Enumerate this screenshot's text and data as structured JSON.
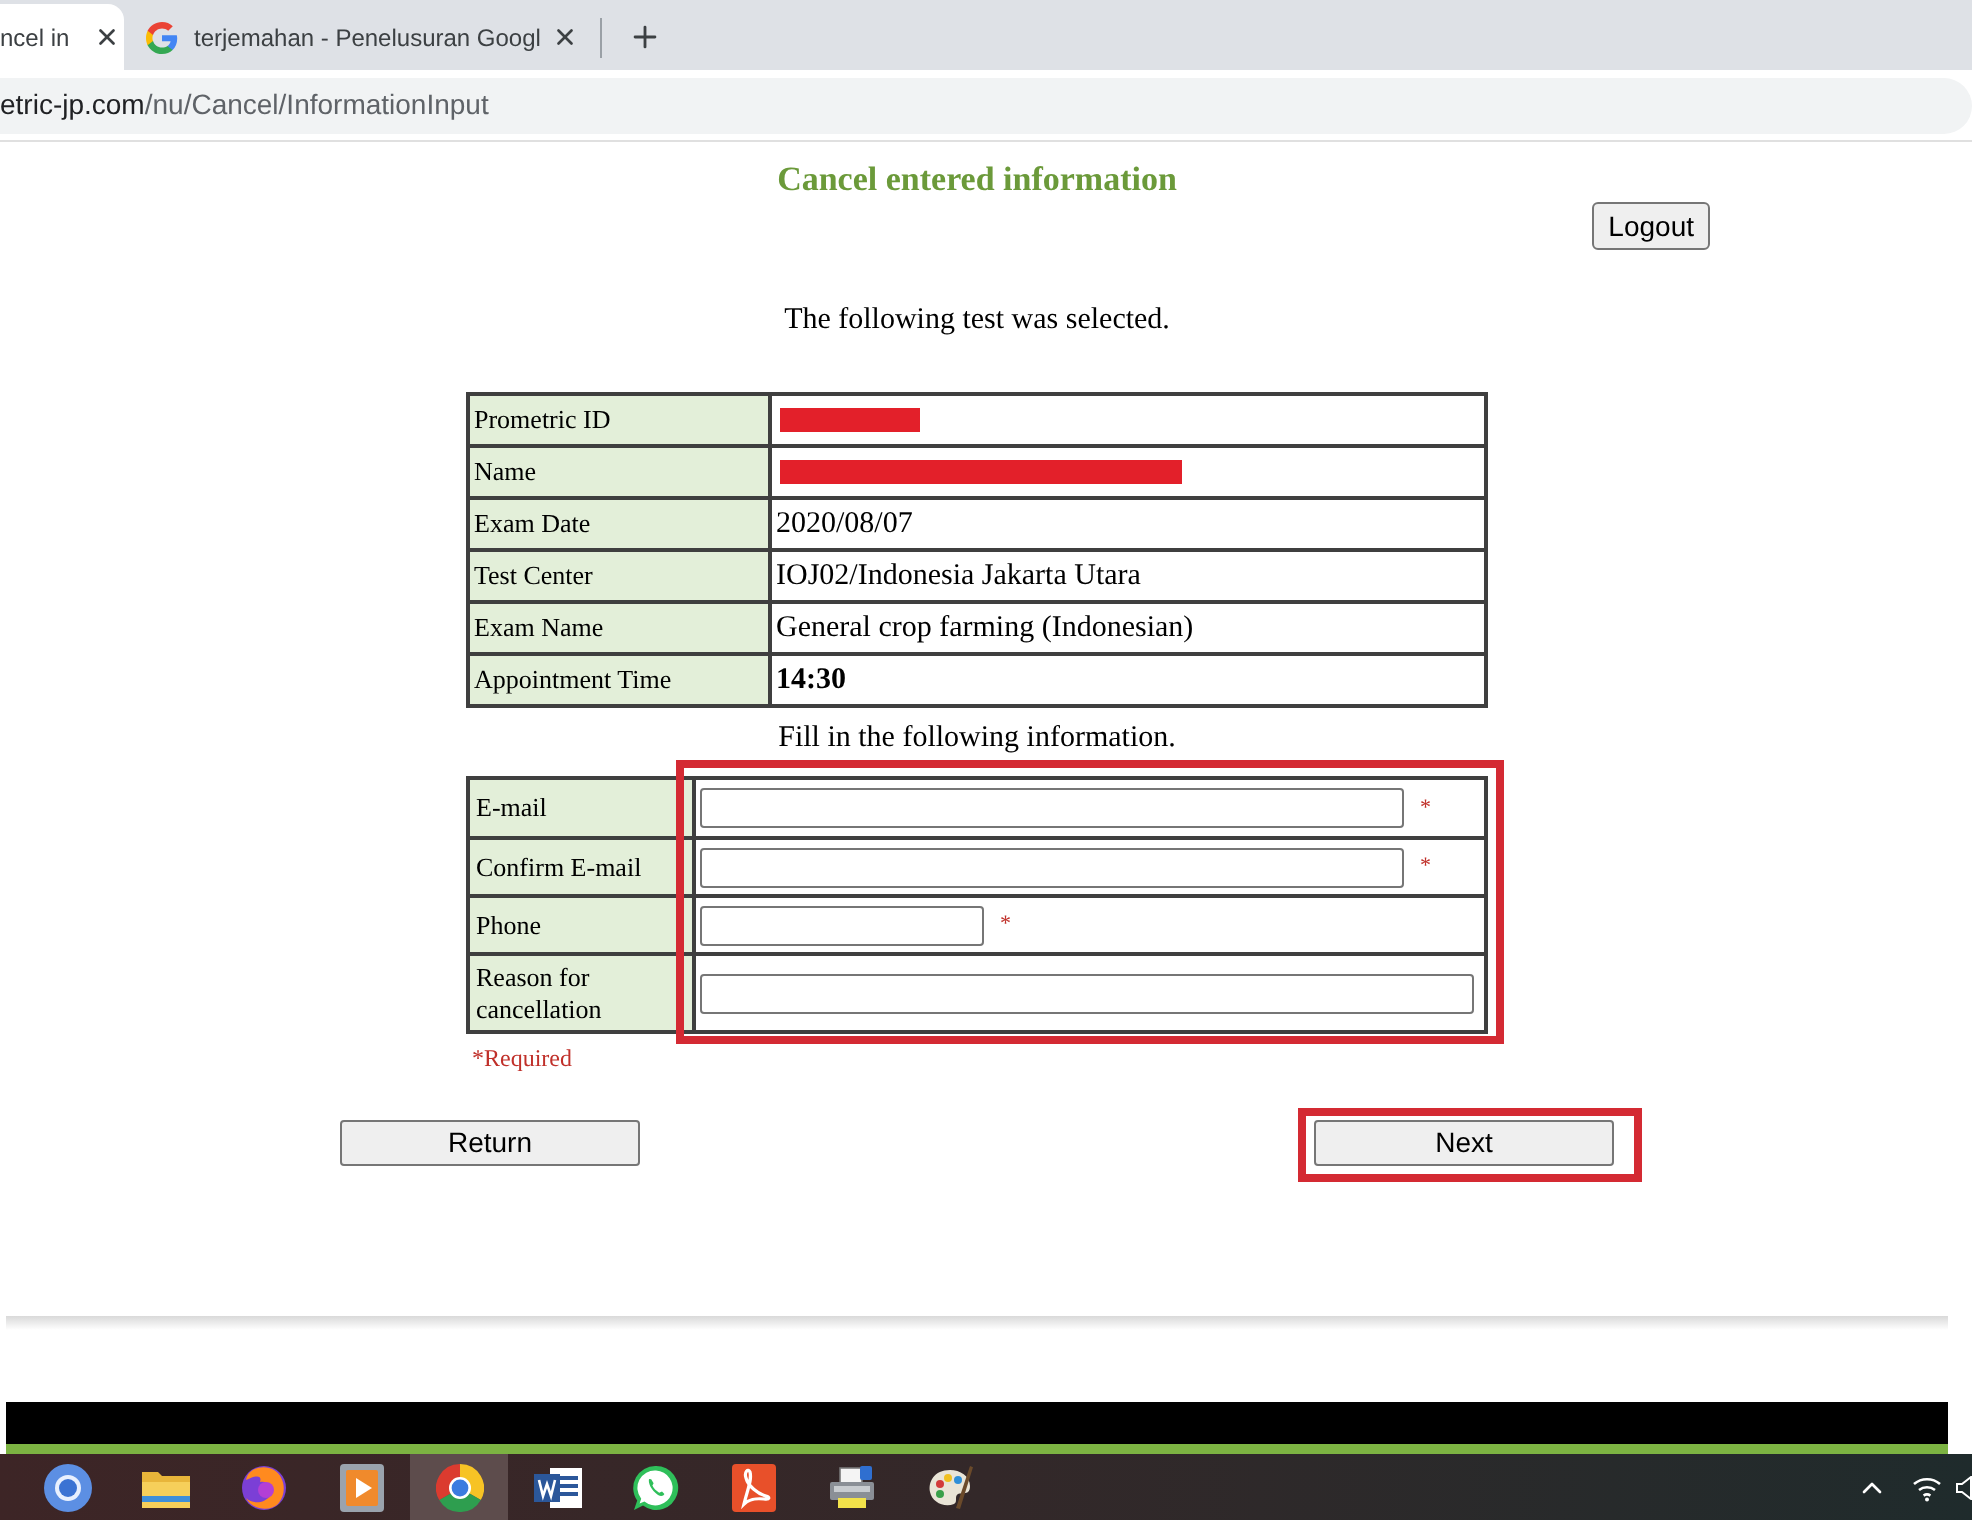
{
  "browser": {
    "tabs": [
      {
        "label": "ncel in",
        "selected": true
      },
      {
        "label": "terjemahan - Penelusuran Googl",
        "selected": false
      }
    ],
    "address_host": "etric-jp.com",
    "address_path": "/nu/Cancel/InformationInput"
  },
  "page": {
    "title": "Cancel entered information",
    "logout_button": "Logout",
    "selected_intro": "The following test was selected.",
    "test_details": [
      {
        "label": "Prometric ID",
        "redacted": true
      },
      {
        "label": "Name",
        "redacted": true
      },
      {
        "label": "Exam Date",
        "value": "2020/08/07"
      },
      {
        "label": "Test Center",
        "value": "IOJ02/Indonesia Jakarta Utara"
      },
      {
        "label": "Exam Name",
        "value": "General crop farming (Indonesian)"
      },
      {
        "label": "Appointment Time",
        "value": "14:30",
        "bold": true
      }
    ],
    "form_intro": "Fill in the following information.",
    "form": {
      "highlighted": true,
      "fields": [
        {
          "label": "E-mail",
          "kind": "long",
          "mark": "*"
        },
        {
          "label": "Confirm E-mail",
          "kind": "long",
          "mark": "*"
        },
        {
          "label": "Phone",
          "kind": "short",
          "mark": "*"
        },
        {
          "label": "Reason for cancellation",
          "kind": "full"
        }
      ]
    },
    "required_note": "*Required",
    "buttons": [
      {
        "label": "Return",
        "highlighted": false
      },
      {
        "label": "Next",
        "highlighted": true
      }
    ]
  },
  "taskbar": {
    "apps": [
      {
        "kind": "round-logo",
        "selected": false
      },
      {
        "kind": "folder",
        "selected": false
      },
      {
        "kind": "flame-globe",
        "selected": false
      },
      {
        "kind": "media",
        "selected": false
      },
      {
        "kind": "ring-logo",
        "selected": true
      },
      {
        "kind": "doc-tile",
        "selected": false
      },
      {
        "kind": "chat",
        "selected": false
      },
      {
        "kind": "curve-tile",
        "selected": false
      },
      {
        "kind": "printer",
        "selected": false
      },
      {
        "kind": "palette",
        "selected": false
      }
    ]
  }
}
